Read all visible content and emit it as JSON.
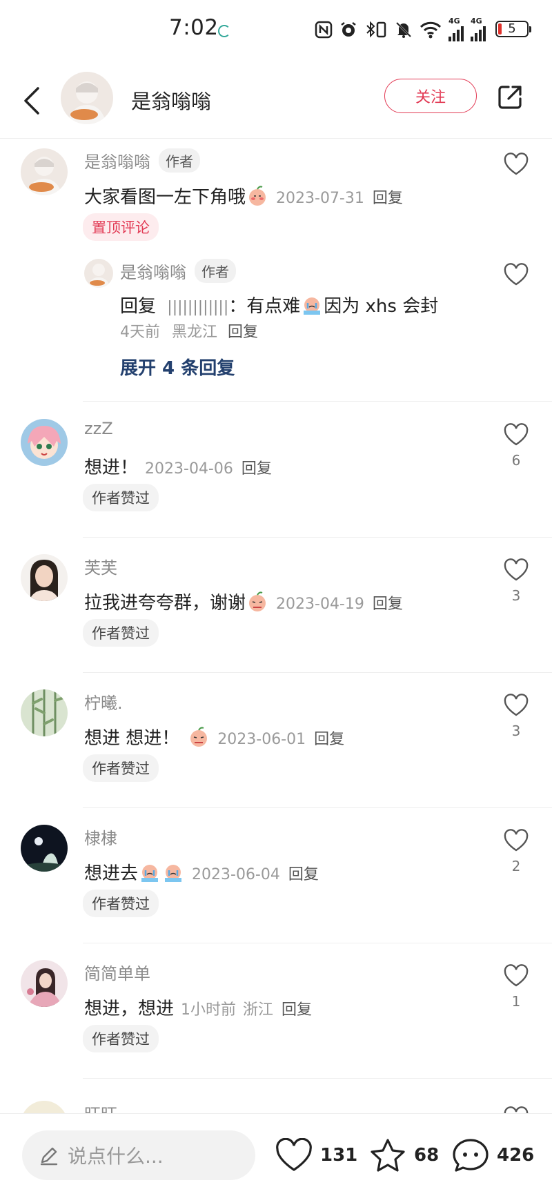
{
  "status_bar": {
    "time": "7:02",
    "network": "4G",
    "battery": "5"
  },
  "header": {
    "username": "是翁嗡嗡",
    "follow_label": "关注"
  },
  "comments": [
    {
      "username": "是翁嗡嗡",
      "author_tag": "作者",
      "text": "大家看图一左下角哦",
      "date": "2023-07-31",
      "reply_label": "回复",
      "badge": "置顶评论",
      "likes": ""
    },
    {
      "username": "是翁嗡嗡",
      "author_tag": "作者",
      "reply_prefix": "回复",
      "reply_target": "||||||||||||",
      "text_after": "有点难",
      "text_after2": "因为 xhs 会封",
      "time": "4天前",
      "location": "黑龙江",
      "reply_label": "回复",
      "expand": "展开 4 条回复"
    },
    {
      "username": "zzZ",
      "text": "想进！",
      "date": "2023-04-06",
      "reply_label": "回复",
      "badge": "作者赞过",
      "likes": "6"
    },
    {
      "username": "芙芙",
      "text": "拉我进夸夸群，谢谢",
      "date": "2023-04-19",
      "reply_label": "回复",
      "badge": "作者赞过",
      "likes": "3"
    },
    {
      "username": "柠曦.",
      "text": "想进 想进！",
      "date": "2023-06-01",
      "reply_label": "回复",
      "badge": "作者赞过",
      "likes": "3"
    },
    {
      "username": "棣棣",
      "text": "想进去",
      "date": "2023-06-04",
      "reply_label": "回复",
      "badge": "作者赞过",
      "likes": "2"
    },
    {
      "username": "简简单单",
      "text": "想进，想进",
      "time": "1小时前",
      "location": "浙江",
      "reply_label": "回复",
      "badge": "作者赞过",
      "likes": "1"
    },
    {
      "username": "旺旺"
    }
  ],
  "bottom_bar": {
    "placeholder": "说点什么...",
    "likes": "131",
    "stars": "68",
    "comments": "426"
  },
  "colors": {
    "accent": "#e23a54",
    "expand_link": "#23406e",
    "muted_text": "#8a8a8a"
  },
  "icons": [
    "back-arrow-icon",
    "share-icon",
    "heart-icon",
    "star-icon",
    "chat-bubble-icon",
    "pen-icon"
  ]
}
